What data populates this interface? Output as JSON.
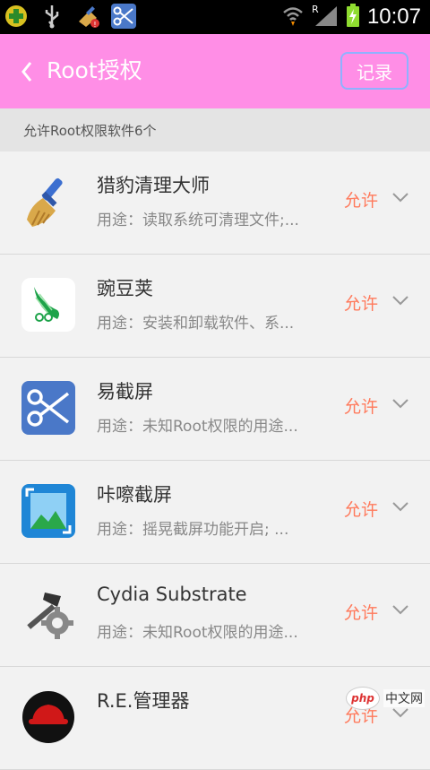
{
  "statusbar": {
    "time": "10:07"
  },
  "header": {
    "title": "Root授权",
    "record_label": "记录"
  },
  "subheader": {
    "text": "允许Root权限软件6个"
  },
  "apps": [
    {
      "name": "猎豹清理大师",
      "desc": "用途：读取系统可清理文件;...",
      "status": "允许",
      "icon": "broom-icon"
    },
    {
      "name": "豌豆荚",
      "desc": "用途：安装和卸载软件、系...",
      "status": "允许",
      "icon": "peapod-icon"
    },
    {
      "name": "易截屏",
      "desc": "用途：未知Root权限的用途...",
      "status": "允许",
      "icon": "scissors-icon"
    },
    {
      "name": "咔嚓截屏",
      "desc": "用途：摇晃截屏功能开启; ...",
      "status": "允许",
      "icon": "screenshot-frame-icon"
    },
    {
      "name": "Cydia Substrate",
      "desc": "用途：未知Root权限的用途...",
      "status": "允许",
      "icon": "hammer-gear-icon"
    },
    {
      "name": "R.E.管理器",
      "desc": "",
      "status": "允许",
      "icon": "redhat-icon"
    }
  ],
  "watermark": {
    "logo": "php",
    "text": "中文网"
  },
  "colors": {
    "header": "#ff8ee6",
    "allow": "#ff7a5c",
    "record_border": "#8fb2ff"
  }
}
